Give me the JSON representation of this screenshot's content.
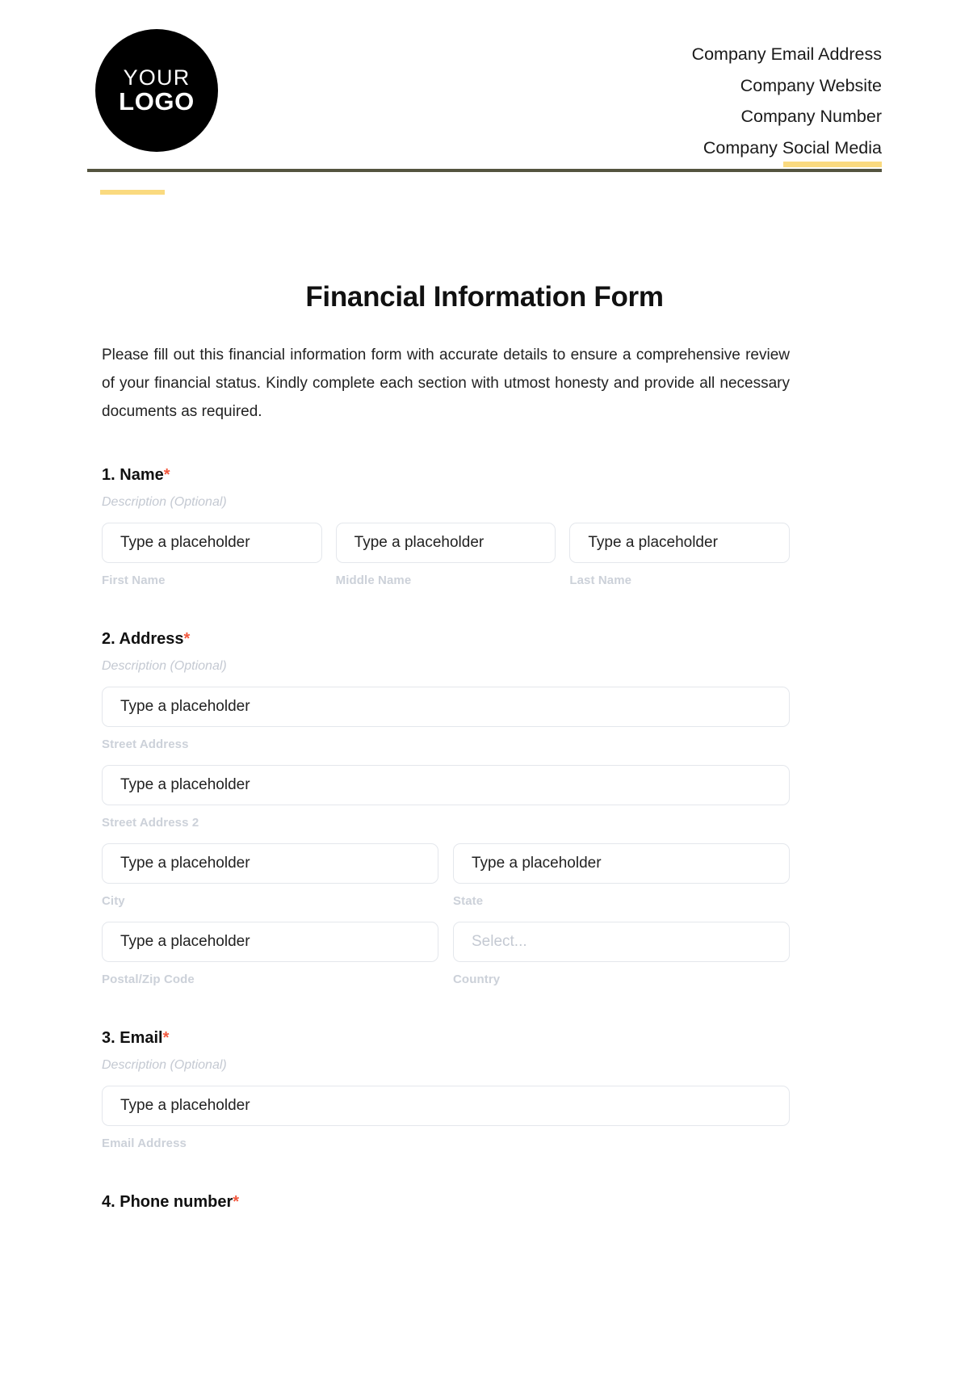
{
  "header": {
    "logo": {
      "line1": "YOUR",
      "line2": "LOGO"
    },
    "contacts": [
      "Company Email Address",
      "Company Website",
      "Company Number",
      "Company Social Media"
    ],
    "accent_yellow": "#fada7f",
    "rule_color": "#54543f"
  },
  "document": {
    "title": "Financial Information Form",
    "intro": "Please fill out this financial information form with accurate details to ensure a comprehensive review of your financial status. Kindly complete each section with utmost honesty and provide all necessary documents as required.",
    "required_marker": "*",
    "required_color": "#f2583e",
    "description_placeholder": "Description (Optional)",
    "input_placeholder": "Type a placeholder",
    "select_placeholder": "Select..."
  },
  "sections": [
    {
      "number": "1.",
      "title": "Name",
      "required": "*",
      "description": "Description (Optional)",
      "fields": [
        {
          "placeholder": "Type a placeholder",
          "label": "First Name"
        },
        {
          "placeholder": "Type a placeholder",
          "label": "Middle Name"
        },
        {
          "placeholder": "Type a placeholder",
          "label": "Last Name"
        }
      ]
    },
    {
      "number": "2.",
      "title": "Address",
      "required": "*",
      "description": "Description (Optional)",
      "fields": [
        {
          "placeholder": "Type a placeholder",
          "label": "Street Address"
        },
        {
          "placeholder": "Type a placeholder",
          "label": "Street Address 2"
        },
        {
          "placeholder": "Type a placeholder",
          "label": "City"
        },
        {
          "placeholder": "Type a placeholder",
          "label": "State"
        },
        {
          "placeholder": "Type a placeholder",
          "label": "Postal/Zip Code"
        },
        {
          "placeholder": "Select...",
          "label": "Country"
        }
      ]
    },
    {
      "number": "3.",
      "title": "Email",
      "required": "*",
      "description": "Description (Optional)",
      "fields": [
        {
          "placeholder": "Type a placeholder",
          "label": "Email Address"
        }
      ]
    },
    {
      "number": "4.",
      "title": "Phone number",
      "required": "*",
      "description": "",
      "fields": []
    }
  ]
}
